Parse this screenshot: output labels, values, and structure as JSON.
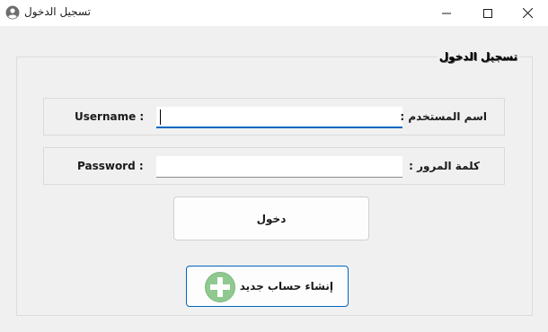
{
  "window": {
    "title": "تسجيل الدخول",
    "icon": "user-circle-icon"
  },
  "form": {
    "group_title": "تسجيل الدخول",
    "username": {
      "label_en": "Username :",
      "label_ar": "اسم المستخدم :",
      "value": "",
      "placeholder": ""
    },
    "password": {
      "label_en": "Password :",
      "label_ar": "كلمة المرور :",
      "value": "",
      "placeholder": ""
    },
    "login_button": "دخول",
    "register_button": "إنشاء حساب جديد"
  },
  "colors": {
    "accent": "#0067c0",
    "plus_green": "#8fc98f",
    "background": "#f0f0f0"
  }
}
